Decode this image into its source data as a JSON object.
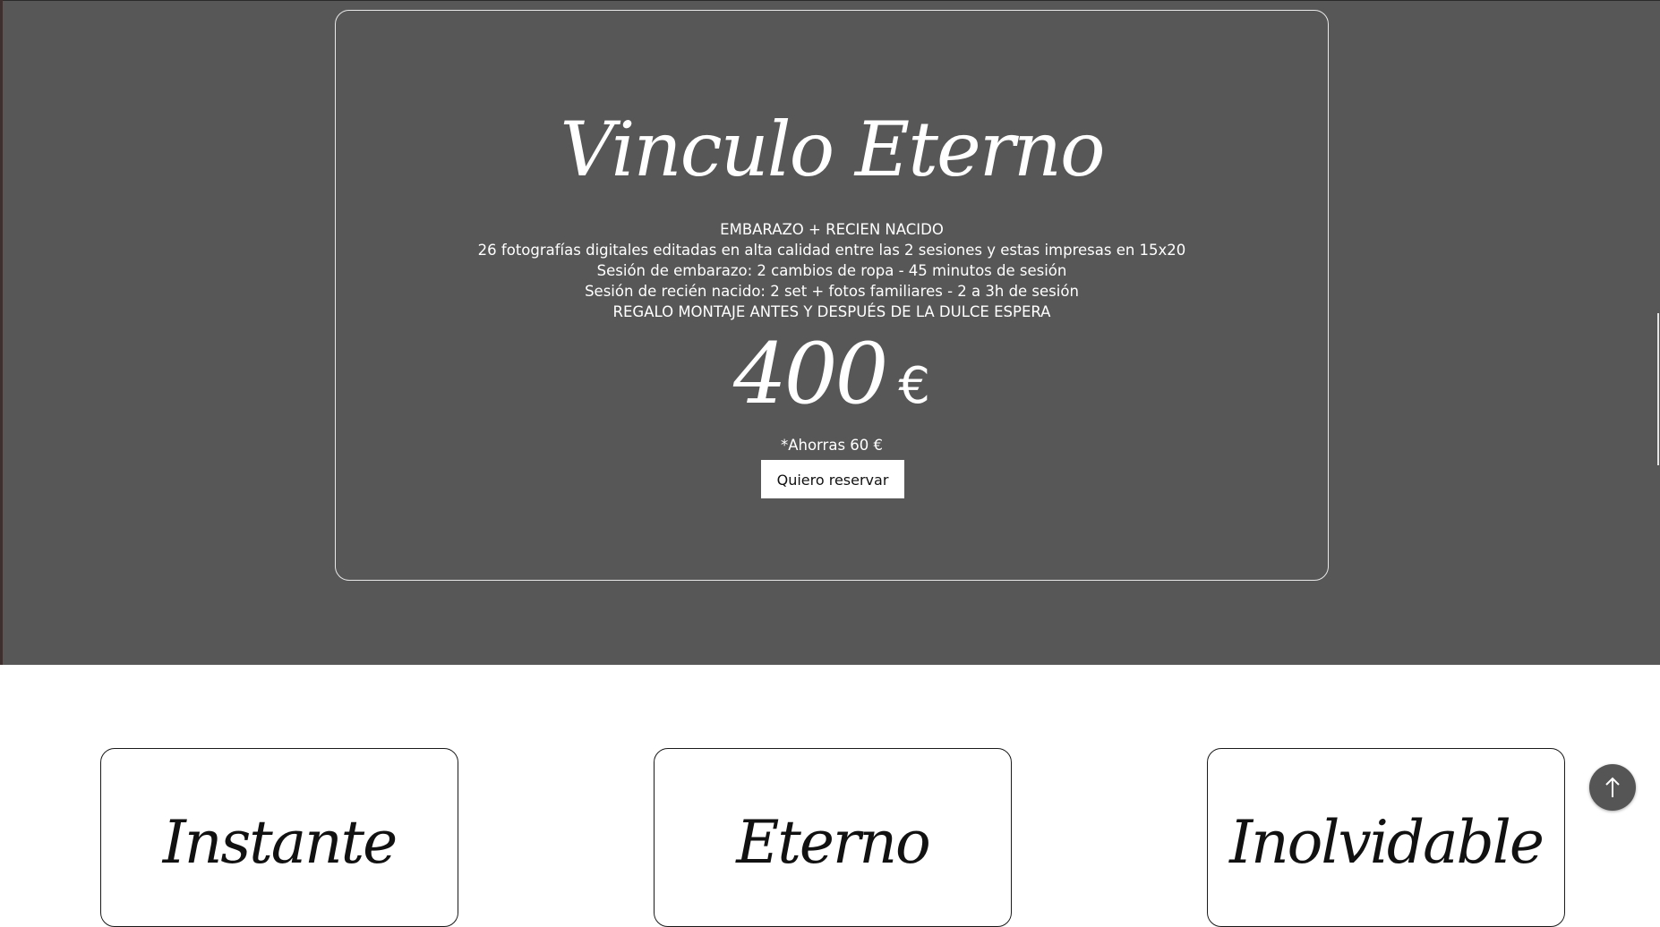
{
  "featured": {
    "title": "Vinculo Eterno",
    "lines": [
      "EMBARAZO + RECIEN NACIDO",
      "26 fotografías digitales editadas en alta calidad entre las 2 sesiones y estas impresas en 15x20",
      "Sesión de embarazo: 2 cambios de ropa - 45 minutos de sesión",
      "Sesión de recién nacido: 2 set + fotos familiares - 2 a 3h de sesión",
      "REGALO MONTAJE ANTES Y DESPUÉS DE LA DULCE ESPERA"
    ],
    "price": "400",
    "currency": "€",
    "saving": "*Ahorras 60 €",
    "button_label": "Quiero reservar"
  },
  "packages": [
    {
      "title": "Instante"
    },
    {
      "title": "Eterno"
    },
    {
      "title": "Inolvidable"
    }
  ],
  "scroll_top": {
    "icon": "arrow-up-icon"
  },
  "colors": {
    "dark_background": "#575757",
    "page_background": "#ffffff",
    "text_light": "#ffffff",
    "scroll_button": "#555555"
  }
}
